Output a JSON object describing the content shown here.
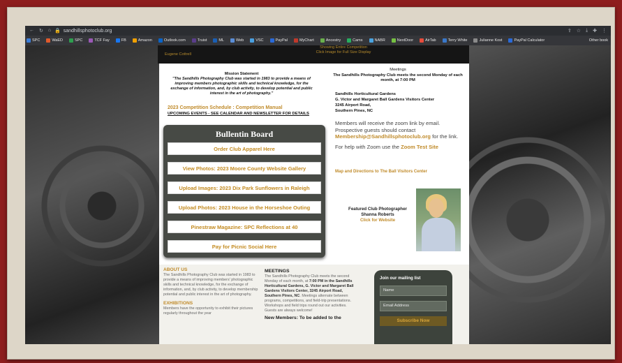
{
  "browser": {
    "url": "sandhillsphotoclub.org",
    "bookmarks": [
      {
        "label": "SPC",
        "color": "#3b7dd8"
      },
      {
        "label": "WaED",
        "color": "#e05a2c"
      },
      {
        "label": "SPC",
        "color": "#2e9e4f"
      },
      {
        "label": "TCF Fay",
        "color": "#9b59b6"
      },
      {
        "label": "FB",
        "color": "#1877f2"
      },
      {
        "label": "Amazon",
        "color": "#f0a000"
      },
      {
        "label": "Outlook.com",
        "color": "#0a64c8"
      },
      {
        "label": "Truist",
        "color": "#5a3d8a"
      },
      {
        "label": "ML",
        "color": "#1a5fb4"
      },
      {
        "label": "Web",
        "color": "#5a8dd6"
      },
      {
        "label": "VSC",
        "color": "#4a9fe0"
      },
      {
        "label": "PayPal",
        "color": "#2a6ad8"
      },
      {
        "label": "MyChart",
        "color": "#c0392b"
      },
      {
        "label": "Ancestry",
        "color": "#6ab04c"
      },
      {
        "label": "Cams",
        "color": "#27ae60"
      },
      {
        "label": "NABR",
        "color": "#4aa3df"
      },
      {
        "label": "NextDoor",
        "color": "#76c043"
      },
      {
        "label": "AirTab",
        "color": "#e74c3c"
      },
      {
        "label": "Terry White",
        "color": "#3a78c9"
      },
      {
        "label": "Julianne Kost",
        "color": "#8a8a8a"
      },
      {
        "label": "PayPal Calculator",
        "color": "#2a6ad8"
      }
    ],
    "other_bookmarks": "Other book"
  },
  "top_strip": {
    "left_text": "Eugene Cottrell",
    "right_line1": "Showing Entire Competition",
    "right_line2": "Click Image for Full Size Display"
  },
  "mission": {
    "heading": "Mission Statement",
    "text": "\"The Sandhills Photography Club was started in 1983 to provide a means of improving members photographic skills and technical knowledge, for the exchange of information, and, by club activity, to develop potential and public interest in the art of photography.\"",
    "competition": "2023 Competition Schedule :  Competition Manual",
    "upcoming": "UPCOMING EVENTS - SEE CALENDAR AND NEWSLETTER FOR DETAILS"
  },
  "board": {
    "title": "Bullentin Board",
    "buttons": [
      "Order Club Apparel Here",
      "View Photos: 2023 Moore County Website Gallery",
      "Upload Images: 2023 Dix Park Sunflowers in Raleigh",
      "Upload Photos: 2023 House in the Horseshoe Outing",
      "Pinestraw Magazine: SPC Reflections at 40",
      "Pay for Picnic Social Here"
    ]
  },
  "meetings": {
    "heading": "Meetings",
    "line": "The Sandhills Photography Club meets the second Monday of each month, at 7:00 PM",
    "venue": [
      "Sandhills  Horticultural Gardens",
      "G. Victor  and  Margaret Ball Gardens Visitors Center",
      "3245  Airport Road,",
      "Southern Pines, NC"
    ],
    "zoom_text1": "Members will receive the zoom link by email. Prospective guests should contact",
    "zoom_email": "Membership@Sandhillsphotoclub.org",
    "zoom_text2": "for the link.",
    "zoom_help": "For help with Zoom use the",
    "zoom_site": "Zoom Test Site",
    "map_link": "Map and Directions to The Ball Visitors Center"
  },
  "featured": {
    "label": "Featured Club Photographer",
    "name": "Shanna Roberts",
    "link": "Click for Website"
  },
  "about": {
    "heading": "ABOUT US",
    "text": "The Sandhills Photography Club was started in 1983 to provide a means of improving members' photographic skills and technical knowledge, for the exchange of information, and, by club activity, to develop membership potential and public interest in the art of photography.",
    "exhibitions_heading": "EXHIBITIONS",
    "exhibitions_text": "Members have the opportunity to exhibit their pictures regularly throughout the year"
  },
  "meetings_lower": {
    "heading": "MEETINGS",
    "text_a": "The Sandhills Photography Club meets the second Monday of each month, at",
    "time": "7:00 PM in the Sandhills  Horticultural Gardens, G. Victor  and Margaret Ball Gardens Visitors Center, 3245  Airport Road, Southern Pines, NC",
    "text_b": ". Meetings alternate between programs, competitions, and field-trip presentations. Workshops and field trips round out our activities. Guests are always welcome!",
    "new_members": "New Members: To be added to the"
  },
  "mailing": {
    "heading": "Join our mailing list",
    "name_placeholder": "Name",
    "email_placeholder": "Email Address",
    "button": "Subscribe Now"
  }
}
